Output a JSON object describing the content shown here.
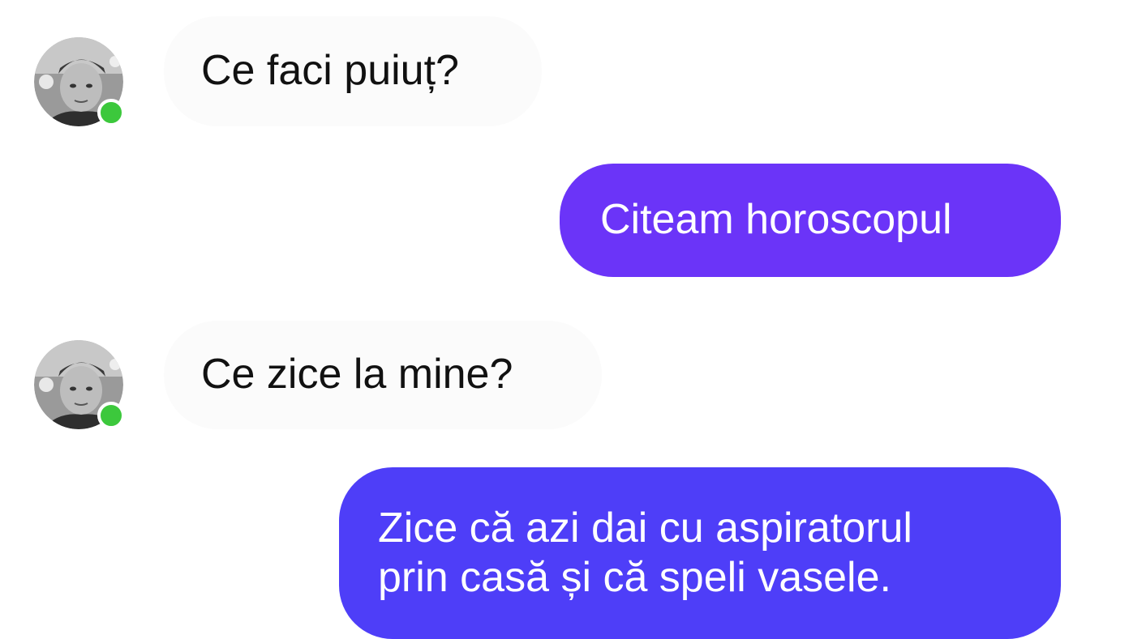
{
  "colors": {
    "outgoing_bubble_1": "#6b34f8",
    "outgoing_bubble_2": "#4e3ef8",
    "incoming_bubble": "#fbfbfb",
    "online_indicator": "#3cc83c"
  },
  "messages": [
    {
      "direction": "incoming",
      "text": "Ce faci puiuț?",
      "avatar": "contact-photo",
      "online": true
    },
    {
      "direction": "outgoing",
      "text": "Citeam horoscopul"
    },
    {
      "direction": "incoming",
      "text": "Ce zice la mine?",
      "avatar": "contact-photo",
      "online": true
    },
    {
      "direction": "outgoing",
      "lines": [
        "Zice că azi dai cu aspiratorul",
        "prin casă și că speli vasele."
      ]
    }
  ]
}
